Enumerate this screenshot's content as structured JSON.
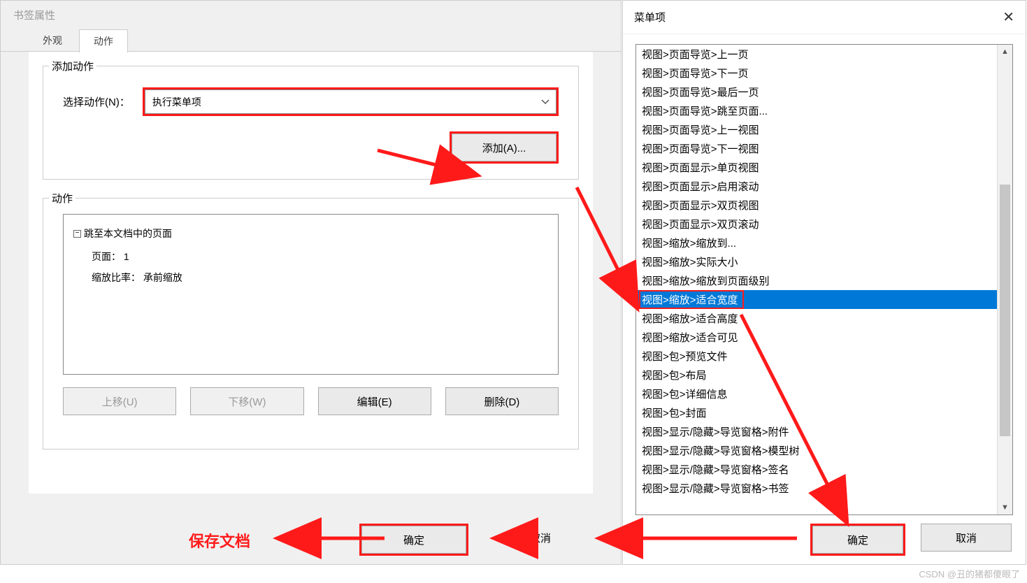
{
  "left": {
    "title": "书签属性",
    "tabs": {
      "appearance": "外观",
      "action": "动作"
    },
    "addAction": {
      "legend": "添加动作",
      "selectLabel": "选择动作(N)：",
      "selectValue": "执行菜单项",
      "addBtn": "添加(A)..."
    },
    "actionList": {
      "legend": "动作",
      "treeHead": "跳至本文档中的页面",
      "pageLabel": "页面：",
      "pageValue": "1",
      "zoomLabel": "缩放比率：",
      "zoomValue": "承前缩放",
      "btnUp": "上移(U)",
      "btnDown": "下移(W)",
      "btnEdit": "编辑(E)",
      "btnDel": "删除(D)"
    },
    "footer": {
      "ok": "确定",
      "cancel": "取消"
    }
  },
  "right": {
    "title": "菜单项",
    "items": [
      "视图>页面导览>上一页",
      "视图>页面导览>下一页",
      "视图>页面导览>最后一页",
      "视图>页面导览>跳至页面...",
      "视图>页面导览>上一视图",
      "视图>页面导览>下一视图",
      "视图>页面显示>单页视图",
      "视图>页面显示>启用滚动",
      "视图>页面显示>双页视图",
      "视图>页面显示>双页滚动",
      "视图>缩放>缩放到...",
      "视图>缩放>实际大小",
      "视图>缩放>缩放到页面级别",
      "视图>缩放>适合宽度",
      "视图>缩放>适合高度",
      "视图>缩放>适合可见",
      "视图>包>预览文件",
      "视图>包>布局",
      "视图>包>详细信息",
      "视图>包>封面",
      "视图>显示/隐藏>导览窗格>附件",
      "视图>显示/隐藏>导览窗格>模型树",
      "视图>显示/隐藏>导览窗格>签名",
      "视图>显示/隐藏>导览窗格>书签"
    ],
    "selectedIndex": 13,
    "footer": {
      "ok": "确定",
      "cancel": "取消"
    }
  },
  "annotations": {
    "saveDoc": "保存文档",
    "watermark": "CSDN @丑的猪都傻眼了"
  }
}
